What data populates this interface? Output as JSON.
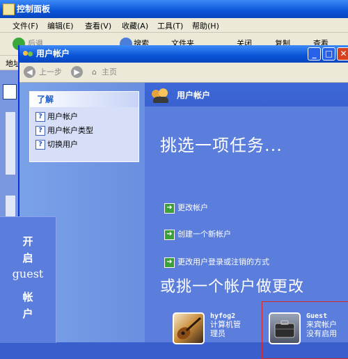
{
  "bg_window": {
    "title": "控制面板",
    "menu": [
      "文件(F)",
      "编辑(E)",
      "查看(V)",
      "收藏(A)",
      "工具(T)",
      "帮助(H)"
    ],
    "toolbar": [
      "后退",
      "搜索",
      "文件夹",
      "关闭",
      "复制",
      "查看"
    ],
    "address_label": "地址"
  },
  "window": {
    "title": "用户帐户",
    "nav": {
      "back": "上一步",
      "home": "主页"
    },
    "learn": {
      "heading": "了解",
      "items": [
        {
          "label": "用户帐户"
        },
        {
          "label": "用户帐户类型"
        },
        {
          "label": "切换用户"
        }
      ]
    },
    "header_title": "用户帐户",
    "pick_task": "挑选一项任务...",
    "tasks": [
      {
        "label": "更改帐户"
      },
      {
        "label": "创建一个新帐户"
      },
      {
        "label": "更改用户登录或注销的方式"
      }
    ],
    "pick_account": "或挑一个帐户做更改",
    "accounts": [
      {
        "name": "hyfog2",
        "line1": "计算机管",
        "line2": "理员"
      },
      {
        "name": "Guest",
        "line1": "来宾帐户",
        "line2": "没有启用"
      }
    ]
  },
  "overlay": {
    "lines": [
      "开",
      "启",
      "guest",
      "帐",
      "户"
    ]
  }
}
